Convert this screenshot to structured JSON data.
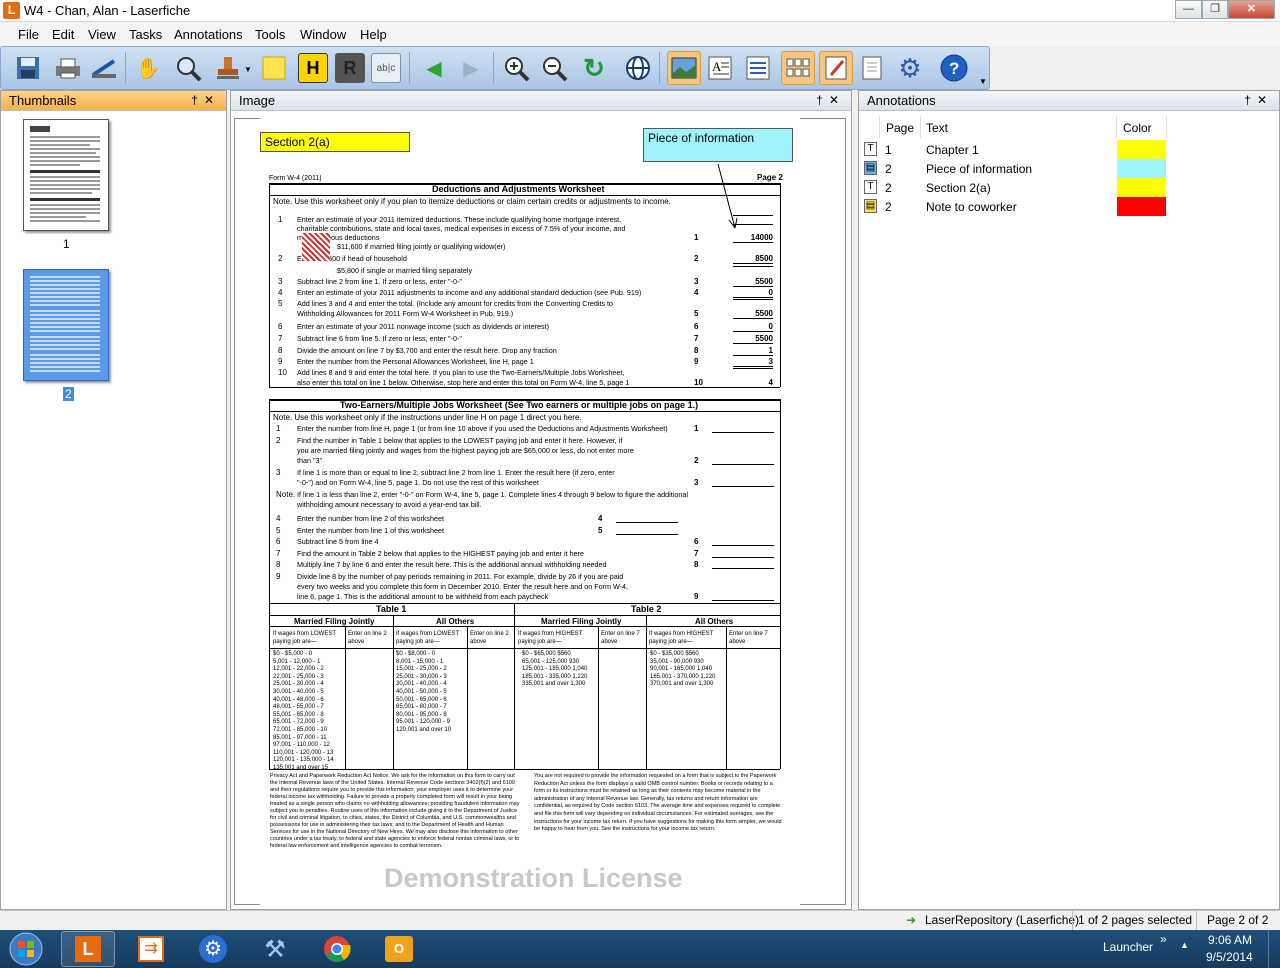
{
  "window": {
    "title": "W4 - Chan, Alan - Laserfiche",
    "app_icon_letter": "L",
    "min": "—",
    "max": "❐",
    "close": "✕"
  },
  "menu": [
    "File",
    "Edit",
    "View",
    "Tasks",
    "Annotations",
    "Tools",
    "Window",
    "Help"
  ],
  "toolbar": {
    "highlight_label": "H",
    "redact_label": "R",
    "text_label": "ab|c"
  },
  "panels": {
    "thumbnails": {
      "title": "Thumbnails",
      "pin": "†",
      "close": "✕",
      "pages": [
        "1",
        "2"
      ]
    },
    "image": {
      "title": "Image",
      "pin": "†",
      "close": "✕"
    },
    "annotations": {
      "title": "Annotations",
      "pin": "†",
      "close": "✕",
      "columns": [
        "Page",
        "Text",
        "Color"
      ],
      "rows": [
        {
          "icon": "text-annotation-icon",
          "glyph": "T",
          "page": "1",
          "text": "Chapter 1",
          "color": "#ffff00"
        },
        {
          "icon": "sticky-note-blue-icon",
          "glyph": "▤",
          "page": "2",
          "text": "Piece of information",
          "color": "#9ff3fb"
        },
        {
          "icon": "text-annotation-icon",
          "glyph": "T",
          "page": "2",
          "text": "Section 2(a)",
          "color": "#ffff00"
        },
        {
          "icon": "sticky-note-yellow-icon",
          "glyph": "▤",
          "page": "2",
          "text": "Note to coworker",
          "color": "#ff0000"
        }
      ]
    }
  },
  "document": {
    "sticky_section": "Section 2(a)",
    "sticky_info": "Piece of information",
    "form_id": "Form W-4 (2011)",
    "page_label": "Page 2",
    "ws1_title": "Deductions and Adjustments Worksheet",
    "ws1_note": "Note. Use this worksheet only if you plan to itemize deductions or claim certain credits or adjustments to income.",
    "ws1_lines": [
      {
        "n": "1",
        "t": "Enter an estimate of your 2011 itemized deductions. These include qualifying home mortgage interest,",
        "ln": "",
        "amt": ""
      },
      {
        "n": "",
        "t": "charitable contributions, state and local taxes, medical expenses in excess of 7.5% of your income, and",
        "ln": "",
        "amt": ""
      },
      {
        "n": "",
        "t": "miscellaneous deductions",
        "ln": "1",
        "amt": "14000"
      },
      {
        "n": "",
        "t": "$11,600 if married filing jointly or qualifying widow(er)",
        "ln": "",
        "amt": ""
      },
      {
        "n": "2",
        "t": "Enter:  $8,500 if head of household",
        "ln": "2",
        "amt": "8500"
      },
      {
        "n": "",
        "t": "$5,800 if single or married filing separately",
        "ln": "",
        "amt": ""
      },
      {
        "n": "3",
        "t": "Subtract line 2 from line 1. If zero or less, enter \"-0-\"",
        "ln": "3",
        "amt": "5500"
      },
      {
        "n": "4",
        "t": "Enter an estimate of your 2011 adjustments to income and any additional standard deduction (see Pub. 919)",
        "ln": "4",
        "amt": "0"
      },
      {
        "n": "5",
        "t": "Add lines 3 and 4 and enter the total. (Include any amount for credits from the Converting Credits to",
        "ln": "",
        "amt": ""
      },
      {
        "n": "",
        "t": "Withholding Allowances for 2011 Form W-4 Worksheet in Pub. 919.)",
        "ln": "5",
        "amt": "5500"
      },
      {
        "n": "6",
        "t": "Enter an estimate of your 2011 nonwage income (such as dividends or interest)",
        "ln": "6",
        "amt": "0"
      },
      {
        "n": "7",
        "t": "Subtract line 6 from line 5. If zero or less, enter \"-0-\"",
        "ln": "7",
        "amt": "5500"
      },
      {
        "n": "8",
        "t": "Divide the amount on line 7 by $3,700 and enter the result here. Drop any fraction",
        "ln": "8",
        "amt": "1"
      },
      {
        "n": "9",
        "t": "Enter the number from the Personal Allowances Worksheet, line H, page 1",
        "ln": "9",
        "amt": "3"
      },
      {
        "n": "10",
        "t": "Add lines 8 and 9 and enter the total here. If you plan to use the Two-Earners/Multiple Jobs Worksheet,",
        "ln": "",
        "amt": ""
      },
      {
        "n": "",
        "t": "also enter this total on line 1 below. Otherwise, stop here and enter this total on Form W-4, line 5, page 1",
        "ln": "10",
        "amt": "4"
      }
    ],
    "ws2_title": "Two-Earners/Multiple Jobs Worksheet (See Two earners or multiple jobs on page 1.)",
    "ws2_note": "Note. Use this worksheet only if the instructions under line H on page 1 direct you here.",
    "ws2_lines": [
      {
        "n": "1",
        "t": "Enter the number from line H, page 1 (or from line 10 above if you used the Deductions and Adjustments Worksheet)",
        "ln": "1"
      },
      {
        "n": "2",
        "t": "Find the number in Table 1 below that applies to the LOWEST paying job and enter it here. However, if",
        "ln": ""
      },
      {
        "n": "",
        "t": "you are married filing jointly and wages from the highest paying job are $65,000 or less, do not enter more",
        "ln": ""
      },
      {
        "n": "",
        "t": "than \"3\"",
        "ln": "2"
      },
      {
        "n": "3",
        "t": "If line 1 is more than or equal to line 2, subtract line 2 from line 1. Enter the result here (if zero, enter",
        "ln": ""
      },
      {
        "n": "",
        "t": "\"-0-\") and on Form W-4, line 5, page 1. Do not use the rest of this worksheet",
        "ln": "3"
      },
      {
        "n": "Note.",
        "t": "If line 1 is less than line 2, enter \"-0-\" on Form W-4, line 5, page 1. Complete lines 4 through 9 below to figure the additional",
        "ln": ""
      },
      {
        "n": "",
        "t": "withholding amount necessary to avoid a year-end tax bill.",
        "ln": ""
      },
      {
        "n": "4",
        "t": "Enter the number from line 2 of this worksheet",
        "ln": "4"
      },
      {
        "n": "5",
        "t": "Enter the number from line 1 of this worksheet",
        "ln": "5"
      },
      {
        "n": "6",
        "t": "Subtract line 5 from line 4",
        "ln": "6"
      },
      {
        "n": "7",
        "t": "Find the amount in Table 2 below that applies to the HIGHEST paying job and enter it here",
        "ln": "7"
      },
      {
        "n": "8",
        "t": "Multiply line 7 by line 6 and enter the result here. This is the additional annual withholding needed",
        "ln": "8"
      },
      {
        "n": "9",
        "t": "Divide line 8 by the number of pay periods remaining in 2011. For example, divide by 26 if you are paid",
        "ln": ""
      },
      {
        "n": "",
        "t": "every two weeks and you complete this form in December 2010. Enter the result here and on Form W-4,",
        "ln": ""
      },
      {
        "n": "",
        "t": "line 6, page 1. This is the additional amount to be withheld from each paycheck",
        "ln": "9"
      }
    ],
    "table1_title": "Table 1",
    "table2_title": "Table 2",
    "t1_mfj": "Married Filing Jointly",
    "t1_all": "All Others",
    "t2_mfj": "Married Filing Jointly",
    "t2_all": "All Others",
    "col_wages_low": "If wages from LOWEST paying job are—",
    "col_wages_high": "If wages from HIGHEST paying job are—",
    "col_line2": "Enter on line 2 above",
    "col_line7": "Enter on line 7 above",
    "t1_mfj_rows": [
      "$0 - $5,000 - 0",
      "5,001 - 12,000 - 1",
      "12,001 - 22,000 - 2",
      "22,001 - 25,000 - 3",
      "25,001 - 30,000 - 4",
      "30,001 - 40,000 - 5",
      "40,001 - 48,000 - 6",
      "48,001 - 55,000 - 7",
      "55,001 - 65,000 - 8",
      "65,001 - 72,000 - 9",
      "72,001 - 85,000 - 10",
      "85,001 - 97,000 - 11",
      "97,001 - 110,000 - 12",
      "110,001 - 120,000 - 13",
      "120,001 - 135,000 - 14",
      "135,001 and over 15"
    ],
    "t1_all_rows": [
      "$0 - $8,000 - 0",
      "8,001 - 15,000 - 1",
      "15,001 - 25,000 - 2",
      "25,001 - 30,000 - 3",
      "30,001 - 40,000 - 4",
      "40,001 - 50,000 - 5",
      "50,001 - 65,000 - 6",
      "65,001 - 80,000 - 7",
      "80,001 - 95,000 - 8",
      "95,001 - 120,000 - 9",
      "120,001 and over 10"
    ],
    "t2_mfj_rows": [
      "$0 - $65,000 $560",
      "65,001 - 125,000 930",
      "125,001 - 185,000 1,040",
      "185,001 - 335,000 1,220",
      "335,001 and over 1,300"
    ],
    "t2_all_rows": [
      "$0 - $35,000 $560",
      "35,001 - 90,000 930",
      "90,001 - 165,000 1,040",
      "165,001 - 370,000 1,220",
      "370,001 and over 1,300"
    ],
    "privacy_left": "Privacy Act and Paperwork Reduction Act Notice. We ask for the information on this form to carry out the Internal Revenue laws of the United States. Internal Revenue Code sections 3402(f)(2) and 6109 and their regulations require you to provide this information; your employer uses it to determine your federal income tax withholding. Failure to provide a properly completed form will result in your being treated as a single person who claims no withholding allowances; providing fraudulent information may subject you to penalties. Routine uses of this information include giving it to the Department of Justice for civil and criminal litigation, to cities, states, the District of Columbia, and U.S. commonwealths and possessions for use in administering their tax laws; and to the Department of Health and Human Services for use in the National Directory of New Hires. We may also disclose this information to other countries under a tax treaty, to federal and state agencies to enforce federal nontax criminal laws, or to federal law enforcement and intelligence agencies to combat terrorism.",
    "privacy_right": "You are not required to provide the information requested on a form that is subject to the Paperwork Reduction Act unless the form displays a valid OMB control number. Books or records relating to a form or its instructions must be retained as long as their contents may become material in the administration of any Internal Revenue law. Generally, tax returns and return information are confidential, as required by Code section 6103. The average time and expenses required to complete and file this form will vary depending on individual circumstances. For estimated averages, see the instructions for your income tax return. If you have suggestions for making this form simpler, we would be happy to hear from you. See the instructions for your income tax return.",
    "watermark": "Demonstration License"
  },
  "status": {
    "repository": "LaserRepository (Laserfiche)",
    "selection": "1 of 2 pages selected",
    "page": "Page 2 of 2"
  },
  "taskbar": {
    "launcher": "Launcher",
    "chevron": "»",
    "time": "9:06 AM",
    "date": "9/5/2014"
  }
}
